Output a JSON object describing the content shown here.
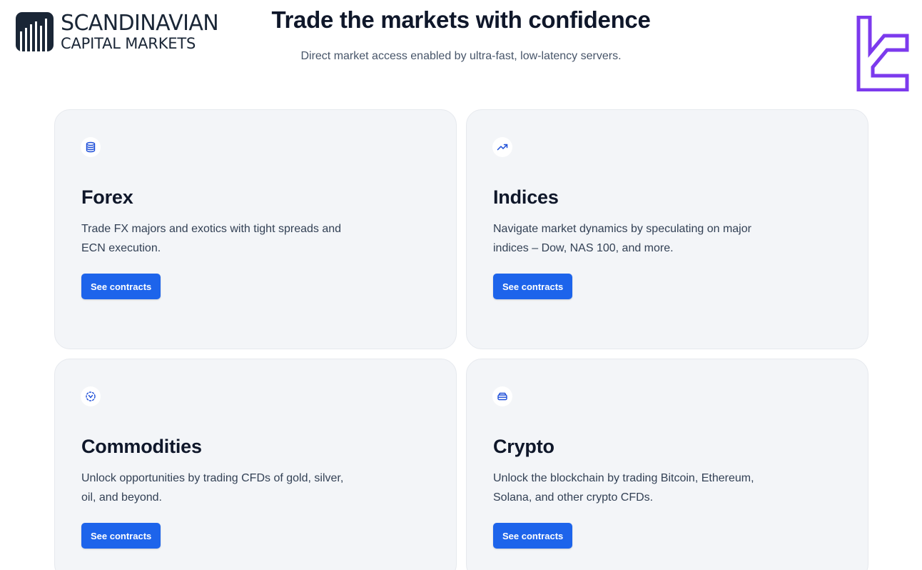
{
  "brand": {
    "line1": "SCANDINAVIAN",
    "line2": "CAPITAL MARKETS"
  },
  "hero": {
    "title": "Trade the markets with confidence",
    "subtitle": "Direct market access enabled by ultra-fast, low-latency servers."
  },
  "colors": {
    "button": "#1d64eb",
    "card_bg": "#f3f5f8",
    "icon": "#1d4ed8",
    "watermark": "#7c3aed"
  },
  "cards": [
    {
      "icon": "database-icon",
      "title": "Forex",
      "description": "Trade FX majors and exotics with tight spreads and ECN execution.",
      "button": "See contracts"
    },
    {
      "icon": "trending-up-icon",
      "title": "Indices",
      "description": "Navigate market dynamics by speculating on major indices – Dow, NAS 100, and more.",
      "button": "See contracts"
    },
    {
      "icon": "scan-target-icon",
      "title": "Commodities",
      "description": "Unlock opportunities by trading CFDs of gold, silver, oil, and beyond.",
      "button": "See contracts"
    },
    {
      "icon": "server-icon",
      "title": "Crypto",
      "description": "Unlock the blockchain by trading Bitcoin, Ethereum, Solana, and other crypto CFDs.",
      "button": "See contracts"
    }
  ]
}
